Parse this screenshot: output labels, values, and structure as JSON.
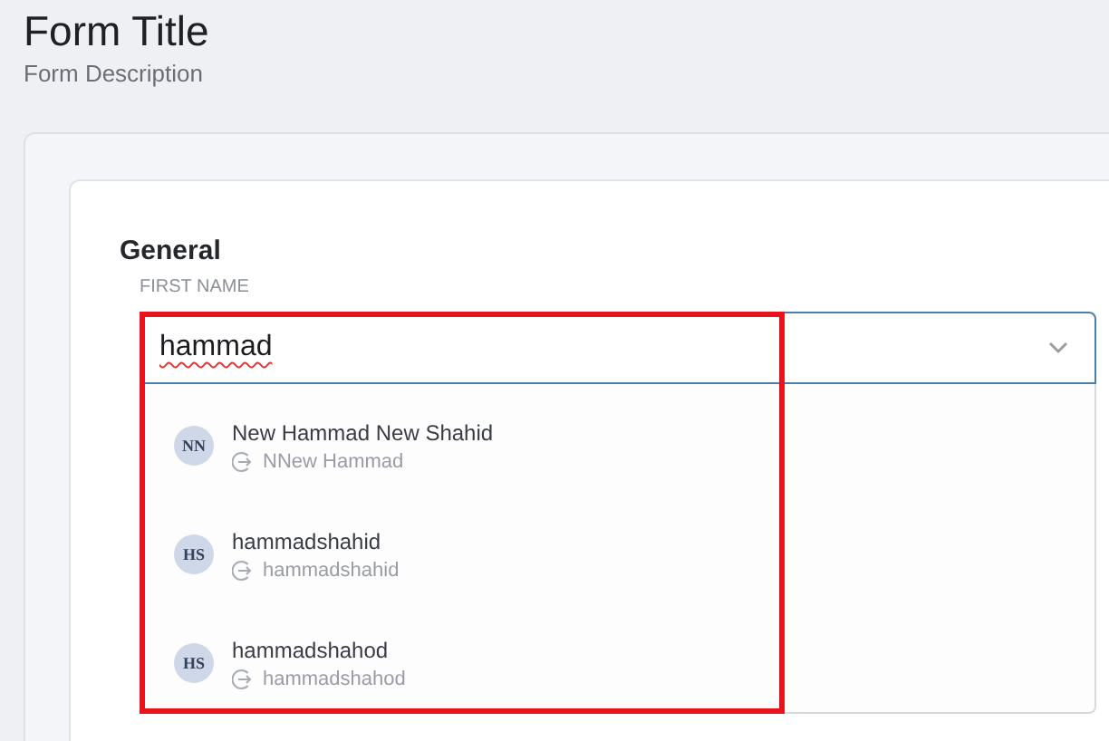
{
  "header": {
    "title": "Form Title",
    "description": "Form Description"
  },
  "section": {
    "title": "General"
  },
  "field": {
    "label": "FIRST NAME",
    "value": "hammad",
    "expanded": true,
    "highlighted": true,
    "options": [
      {
        "initials": "NN",
        "name": "New Hammad New Shahid",
        "detail": "NNew Hammad"
      },
      {
        "initials": "HS",
        "name": "hammadshahid",
        "detail": "hammadshahid"
      },
      {
        "initials": "HS",
        "name": "hammadshahod",
        "detail": "hammadshahod"
      }
    ]
  }
}
